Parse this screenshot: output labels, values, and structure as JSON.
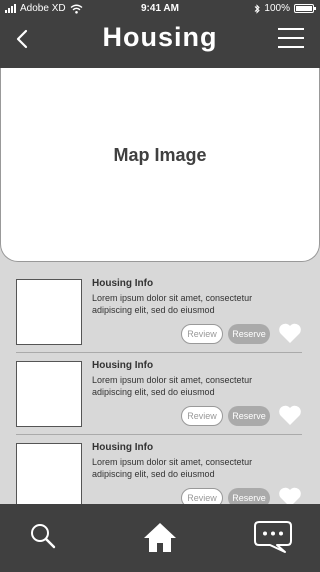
{
  "status_bar": {
    "carrier": "Adobe XD",
    "time": "9:41 AM",
    "battery": "100%"
  },
  "header": {
    "title": "Housing"
  },
  "map": {
    "label": "Map Image"
  },
  "listings": [
    {
      "title": "Housing Info",
      "description": "Lorem ipsum dolor sit amet, consectetur adipiscing elit, sed do eiusmod",
      "review_label": "Review",
      "reserve_label": "Reserve"
    },
    {
      "title": "Housing Info",
      "description": "Lorem ipsum dolor sit amet, consectetur adipiscing elit, sed do eiusmod",
      "review_label": "Review",
      "reserve_label": "Reserve"
    },
    {
      "title": "Housing Info",
      "description": "Lorem ipsum dolor sit amet, consectetur adipiscing elit, sed do eiusmod",
      "review_label": "Review",
      "reserve_label": "Reserve"
    }
  ],
  "tab_bar": {
    "items": [
      "search-icon",
      "home-icon",
      "chat-icon"
    ]
  },
  "colors": {
    "bar_background": "#404040",
    "content_background": "#d8d8d8",
    "reserve_button": "#aaaaaa"
  }
}
